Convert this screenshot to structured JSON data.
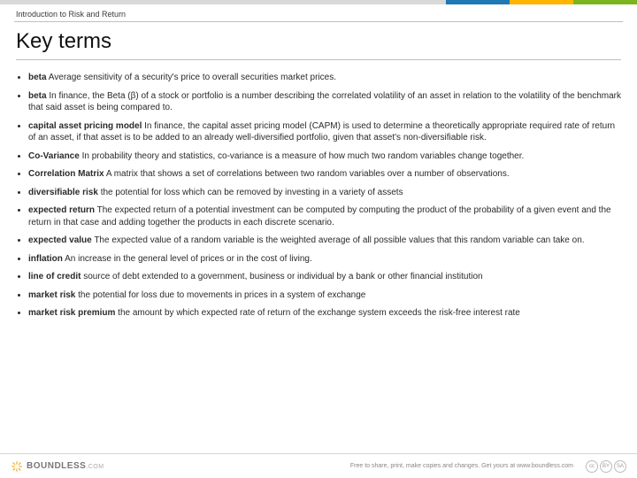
{
  "header": {
    "breadcrumb": "Introduction to Risk and Return",
    "title": "Key terms"
  },
  "terms": [
    {
      "term": "beta",
      "def": "Average sensitivity of a security's price to overall securities market prices."
    },
    {
      "term": "beta",
      "def": "In finance, the Beta (β) of a stock or portfolio is a number describing the correlated volatility of an asset in relation to the volatility of the benchmark that said asset is being compared to."
    },
    {
      "term": "capital asset pricing model",
      "def": "In finance, the capital asset pricing model (CAPM) is used to determine a theoretically appropriate required rate of return of an asset, if that asset is to be added to an already well-diversified portfolio, given that asset's non-diversifiable risk."
    },
    {
      "term": "Co-Variance",
      "def": "In probability theory and statistics, co-variance is a measure of how much two random variables change together."
    },
    {
      "term": "Correlation Matrix",
      "def": "A matrix that shows a set of correlations between two random variables over a number of observations."
    },
    {
      "term": "diversifiable risk",
      "def": "the potential for loss which can be removed by investing in a variety of assets"
    },
    {
      "term": "expected return",
      "def": "The expected return of a potential investment can be computed by computing the product of the probability of a given event and the return in that case and adding together the products in each discrete scenario."
    },
    {
      "term": "expected value",
      "def": "The expected value of a random variable is the weighted average of all possible values that this random variable can take on."
    },
    {
      "term": "inflation",
      "def": "An increase in the general level of prices or in the cost of living."
    },
    {
      "term": "line of credit",
      "def": "source of debt extended to a government, business or individual by a bank or other financial institution"
    },
    {
      "term": "market risk",
      "def": "the potential for loss due to movements in prices in a system of exchange"
    },
    {
      "term": "market risk premium",
      "def": "the amount by which expected rate of return of the exchange system exceeds the risk-free interest rate"
    }
  ],
  "footer": {
    "brand": "BOUNDLESS",
    "brand_suffix": ".COM",
    "tagline": "Free to share, print, make copies and changes. Get yours at www.boundless.com",
    "cc": [
      "cc",
      "BY",
      "SA"
    ]
  }
}
